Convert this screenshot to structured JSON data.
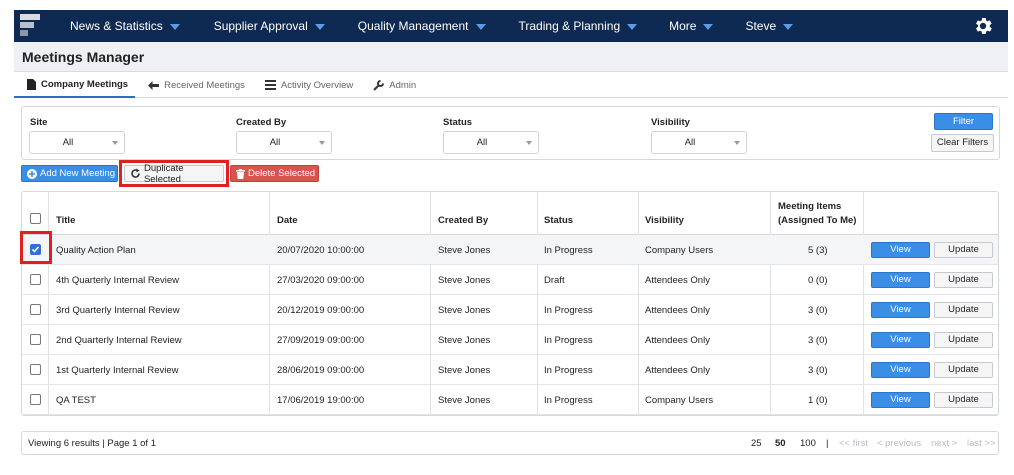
{
  "nav": {
    "items": [
      "News & Statistics",
      "Supplier Approval",
      "Quality Management",
      "Trading & Planning",
      "More",
      "Steve"
    ]
  },
  "page": {
    "title": "Meetings Manager"
  },
  "tabs": [
    "Company Meetings",
    "Received Meetings",
    "Activity Overview",
    "Admin"
  ],
  "filters": {
    "site_label": "Site",
    "site_value": "All",
    "created_by_label": "Created By",
    "created_by_value": "All",
    "status_label": "Status",
    "status_value": "All",
    "visibility_label": "Visibility",
    "visibility_value": "All",
    "filter_button": "Filter",
    "clear_button": "Clear Filters"
  },
  "actions": {
    "add": "Add New Meeting",
    "duplicate": "Duplicate Selected",
    "delete": "Delete Selected"
  },
  "table": {
    "headers": {
      "title": "Title",
      "date": "Date",
      "created_by": "Created By",
      "status": "Status",
      "visibility": "Visibility",
      "items_line1": "Meeting Items",
      "items_line2": "(Assigned To Me)"
    },
    "rows": [
      {
        "title": "Quality Action Plan",
        "date": "20/07/2020 10:00:00",
        "created_by": "Steve Jones",
        "status": "In Progress",
        "visibility": "Company Users",
        "items": "5 (3)",
        "checked": true
      },
      {
        "title": "4th Quarterly Internal Review",
        "date": "27/03/2020 09:00:00",
        "created_by": "Steve Jones",
        "status": "Draft",
        "visibility": "Attendees Only",
        "items": "0 (0)",
        "checked": false
      },
      {
        "title": "3rd Quarterly Internal Review",
        "date": "20/12/2019 09:00:00",
        "created_by": "Steve Jones",
        "status": "In Progress",
        "visibility": "Attendees Only",
        "items": "3 (0)",
        "checked": false
      },
      {
        "title": "2nd Quarterly Internal Review",
        "date": "27/09/2019 09:00:00",
        "created_by": "Steve Jones",
        "status": "In Progress",
        "visibility": "Attendees Only",
        "items": "3 (0)",
        "checked": false
      },
      {
        "title": "1st Quarterly Internal Review",
        "date": "28/06/2019 09:00:00",
        "created_by": "Steve Jones",
        "status": "In Progress",
        "visibility": "Attendees Only",
        "items": "3 (0)",
        "checked": false
      },
      {
        "title": "QA TEST",
        "date": "17/06/2019 19:00:00",
        "created_by": "Steve Jones",
        "status": "In Progress",
        "visibility": "Company Users",
        "items": "1 (0)",
        "checked": false
      }
    ],
    "view_label": "View",
    "update_label": "Update"
  },
  "footer": {
    "summary": "Viewing 6 results | Page 1 of 1",
    "page_sizes": [
      "25",
      "50",
      "100"
    ],
    "separator": "|",
    "first": "<< first",
    "previous": "< previous",
    "next": "next >",
    "last": "last >>"
  }
}
